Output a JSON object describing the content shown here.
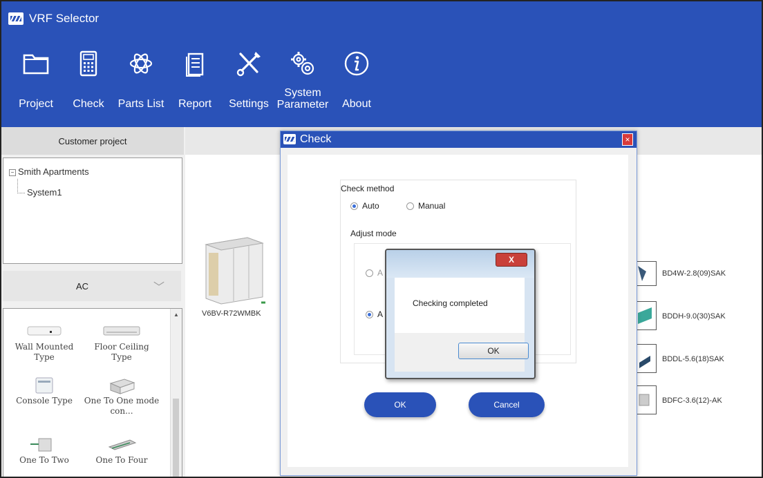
{
  "app": {
    "title": "VRF Selector"
  },
  "toolbar": [
    {
      "label": "Project",
      "icon": "folder-icon"
    },
    {
      "label": "Check",
      "icon": "calculator-icon"
    },
    {
      "label": "Parts List",
      "icon": "parts-icon"
    },
    {
      "label": "Report",
      "icon": "report-icon"
    },
    {
      "label": "Settings",
      "icon": "tools-icon"
    },
    {
      "label": "System Parameter",
      "icon": "gears-icon"
    },
    {
      "label": "About",
      "icon": "info-icon"
    }
  ],
  "left_panel": {
    "header": "Customer project",
    "tree": {
      "project": "Smith Apartments",
      "system": "System1"
    },
    "category": "AC",
    "units": [
      {
        "label": "Wall Mounted Type"
      },
      {
        "label": "Floor Ceiling Type"
      },
      {
        "label": "Console Type"
      },
      {
        "label": "One To One mode con..."
      },
      {
        "label": "One To Two"
      },
      {
        "label": "One To Four"
      }
    ]
  },
  "canvas": {
    "outdoor_unit": "V6BV-R72WMBK",
    "indoor_units": [
      "BD4W-2.8(09)SAK",
      "BDDH-9.0(30)SAK",
      "BDDL-5.6(18)SAK",
      "BDFC-3.6(12)-AK"
    ]
  },
  "check_dialog": {
    "title": "Check",
    "close": "×",
    "check_method_label": "Check method",
    "auto_label": "Auto",
    "manual_label": "Manual",
    "adjust_mode_label": "Adjust mode",
    "option1_label": "A",
    "option2_label": "A",
    "ok_label": "OK",
    "cancel_label": "Cancel"
  },
  "message_box": {
    "close": "X",
    "text": "Checking completed",
    "ok_label": "OK"
  },
  "colors": {
    "ribbon": "#2a52b8",
    "accent": "#2a52b8",
    "close_red": "#d83a3a"
  }
}
